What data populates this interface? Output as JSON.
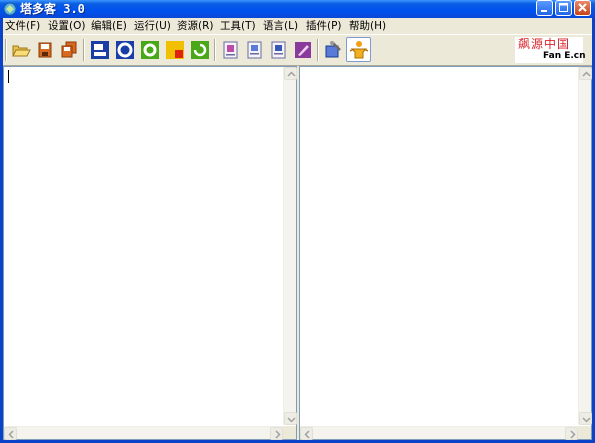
{
  "window": {
    "title": "塔多客 3.0"
  },
  "menu": [
    {
      "label": "文件(F)"
    },
    {
      "label": "设置(O)"
    },
    {
      "label": "编辑(E)"
    },
    {
      "label": "运行(U)"
    },
    {
      "label": "资源(R)"
    },
    {
      "label": "工具(T)"
    },
    {
      "label": "语言(L)"
    },
    {
      "label": "插件(P)"
    },
    {
      "label": "帮助(H)"
    }
  ],
  "toolbar": {
    "buttons": [
      {
        "icon": "open-folder-icon"
      },
      {
        "icon": "save-icon"
      },
      {
        "icon": "save-all-icon"
      },
      {
        "icon": "blue-window-icon"
      },
      {
        "icon": "blue-ring-icon"
      },
      {
        "icon": "green-ring-icon"
      },
      {
        "icon": "yellow-red-square-icon"
      },
      {
        "icon": "green-refresh-icon"
      },
      {
        "icon": "document-icon-1"
      },
      {
        "icon": "document-icon-2"
      },
      {
        "icon": "document-icon-3"
      },
      {
        "icon": "pen-document-icon"
      },
      {
        "icon": "tools-icon"
      },
      {
        "icon": "plugin-figure-icon"
      }
    ]
  },
  "logo": {
    "cn_text": "飙源中国",
    "en_text": "Fan E.cn"
  },
  "colors": {
    "title_bar": "#0050ee",
    "chrome": "#ece9d8",
    "pane_border": "#7f9db9",
    "logo_red": "#d9232a"
  }
}
